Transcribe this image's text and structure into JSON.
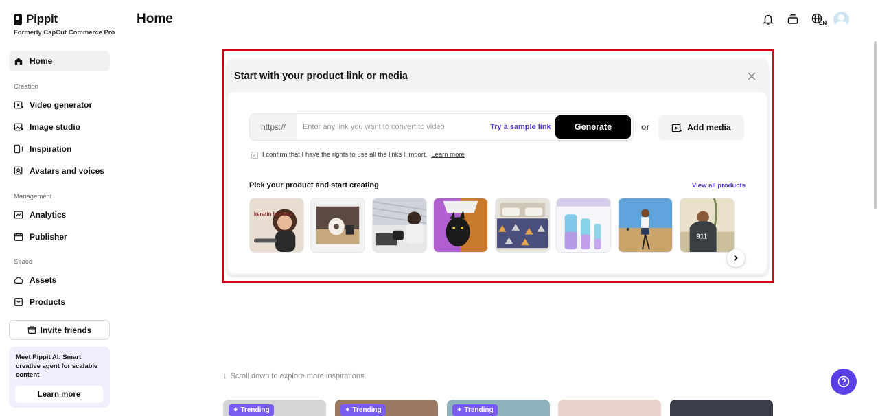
{
  "brand": {
    "name": "Pippit",
    "subtitle": "Formerly CapCut Commerce Pro"
  },
  "sidebar": {
    "home": "Home",
    "sections": {
      "creation": "Creation",
      "management": "Management",
      "space": "Space"
    },
    "creation_items": [
      "Video generator",
      "Image studio",
      "Inspiration",
      "Avatars and voices"
    ],
    "management_items": [
      "Analytics",
      "Publisher"
    ],
    "space_items": [
      "Assets",
      "Products"
    ],
    "invite": "Invite friends",
    "promo": {
      "text": "Meet Pippit AI: Smart creative agent for scalable content",
      "button": "Learn more"
    }
  },
  "header": {
    "title": "Home",
    "lang": "EN"
  },
  "panel": {
    "title": "Start with your product link or media",
    "link_prefix": "https://",
    "link_placeholder": "Enter any link you want to convert to video",
    "sample_link": "Try a sample link",
    "generate": "Generate",
    "or": "or",
    "add_media": "Add media",
    "confirm_text": "I confirm that I have the rights to use all the links I import.",
    "confirm_learn": "Learn more",
    "pick_title": "Pick your product and start creating",
    "view_all": "View all products",
    "thumb_texts": [
      "keratin bristles"
    ]
  },
  "scroll_hint": "Scroll down to explore more inspirations",
  "trending_label": "Trending",
  "colors": {
    "accent": "#4f3bd6",
    "highlight": "#d0021b",
    "trending": "#7b5cf0",
    "help": "#5a3ee6"
  }
}
